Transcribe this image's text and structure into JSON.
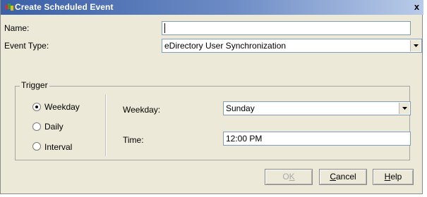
{
  "window": {
    "title": "Create Scheduled Event",
    "close_glyph": "x"
  },
  "form": {
    "name_label": "Name:",
    "name_value": "",
    "event_type_label": "Event Type:",
    "event_type_value": "eDirectory User Synchronization"
  },
  "trigger": {
    "legend": "Trigger",
    "options": [
      {
        "label": "Weekday",
        "checked": true
      },
      {
        "label": "Daily",
        "checked": false
      },
      {
        "label": "Interval",
        "checked": false
      }
    ],
    "weekday_label": "Weekday:",
    "weekday_value": "Sunday",
    "time_label": "Time:",
    "time_value": "12:00 PM"
  },
  "buttons": {
    "ok": {
      "pre": "O",
      "mnemonic": "K",
      "post": "",
      "disabled": true
    },
    "cancel": {
      "pre": "",
      "mnemonic": "C",
      "post": "ancel"
    },
    "help": {
      "pre": "",
      "mnemonic": "H",
      "post": "elp"
    }
  },
  "icons": {
    "app": "novell-app-icon",
    "close": "close-icon",
    "dropdown": "chevron-down-icon"
  }
}
